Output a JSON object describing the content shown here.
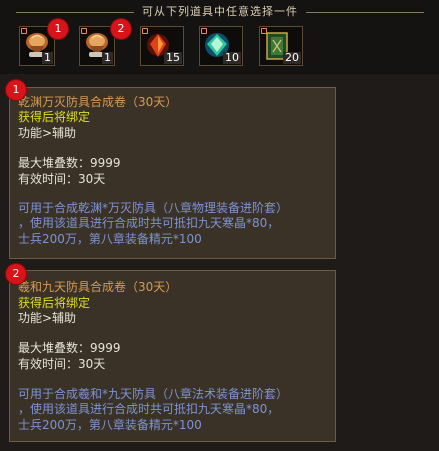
{
  "header": {
    "title": "可从下列道具中任意选择一件"
  },
  "slots": [
    {
      "count": "1",
      "icon": "scroll-icon",
      "badge": "1"
    },
    {
      "count": "1",
      "icon": "scroll-icon",
      "badge": "2"
    },
    {
      "count": "15",
      "icon": "red-crystal-icon"
    },
    {
      "count": "10",
      "icon": "green-gem-icon"
    },
    {
      "count": "20",
      "icon": "green-book-icon"
    }
  ],
  "cards": [
    {
      "badge": "1",
      "name": "乾渊万灭防具合成卷（30天）",
      "bind": "获得后将绑定",
      "function": "功能>辅助",
      "stack": "最大堆叠数：9999",
      "duration": "有效时间：30天",
      "desc1": "可用于合成乾渊*万灭防具（八章物理装备进阶套）",
      "desc2": "，使用该道具进行合成时共可抵扣九天寒晶*80，",
      "desc3": "士兵200万，第八章装备精元*100"
    },
    {
      "badge": "2",
      "name": "羲和九天防具合成卷（30天）",
      "bind": "获得后将绑定",
      "function": "功能>辅助",
      "stack": "最大堆叠数：9999",
      "duration": "有效时间：30天",
      "desc1": "可用于合成羲和*九天防具（八章法术装备进阶套）",
      "desc2": "，使用该道具进行合成时共可抵扣九天寒晶*80，",
      "desc3": "士兵200万，第八章装备精元*100"
    }
  ],
  "colors": {
    "name": "#d89a52",
    "bind": "#dede20",
    "desc": "#7e93d4",
    "badge": "#d8131a"
  }
}
